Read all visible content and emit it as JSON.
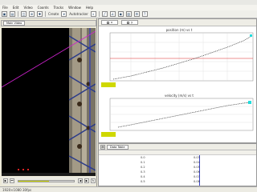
{
  "menu": [
    "File",
    "Edit",
    "Video",
    "Coords",
    "Tracks",
    "Window",
    "Help"
  ],
  "toolbar": {
    "tracks_label": "Create",
    "mode_label": "Autotracker"
  },
  "video": {
    "tab_label": "Main Video",
    "slider_fraction": 0.55
  },
  "plot": {
    "tab_x": "x",
    "tab_y": "y",
    "title_top": "position (m) vs t",
    "title_bottom": "velocity (m/s) vs t"
  },
  "table": {
    "tab_label": "Data Table",
    "rows": [
      {
        "t": "0.0",
        "x": "0.03"
      },
      {
        "t": "0.1",
        "x": "0.04"
      },
      {
        "t": "0.2",
        "x": "0.05"
      },
      {
        "t": "0.3",
        "x": "0.06"
      },
      {
        "t": "0.4",
        "x": "0.07"
      },
      {
        "t": "0.5",
        "x": "0.08"
      }
    ]
  },
  "status": "1920×1080 30fps",
  "colors": {
    "track_line": "#cc22cc",
    "accent_blue": "#2233cc",
    "highlight_yellow": "#cfd800",
    "point_cyan": "#22dddd"
  }
}
